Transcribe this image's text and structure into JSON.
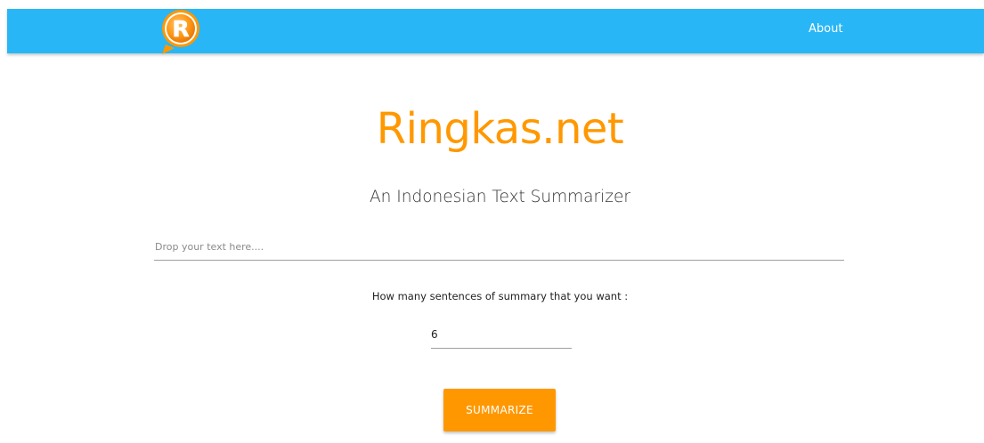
{
  "navbar": {
    "logo_letter": "R",
    "about_label": "About"
  },
  "hero": {
    "title": "Ringkas.net",
    "subtitle": "An Indonesian Text Summarizer"
  },
  "form": {
    "text_input_placeholder": "Drop your text here....",
    "text_input_value": "",
    "sentences_label": "How many sentences of summary that you want :",
    "sentences_value": "6",
    "submit_label": "SUMMARIZE"
  },
  "colors": {
    "navbar": "#29b6f6",
    "accent": "#ff9800",
    "logo_ring": "#ff9800"
  }
}
